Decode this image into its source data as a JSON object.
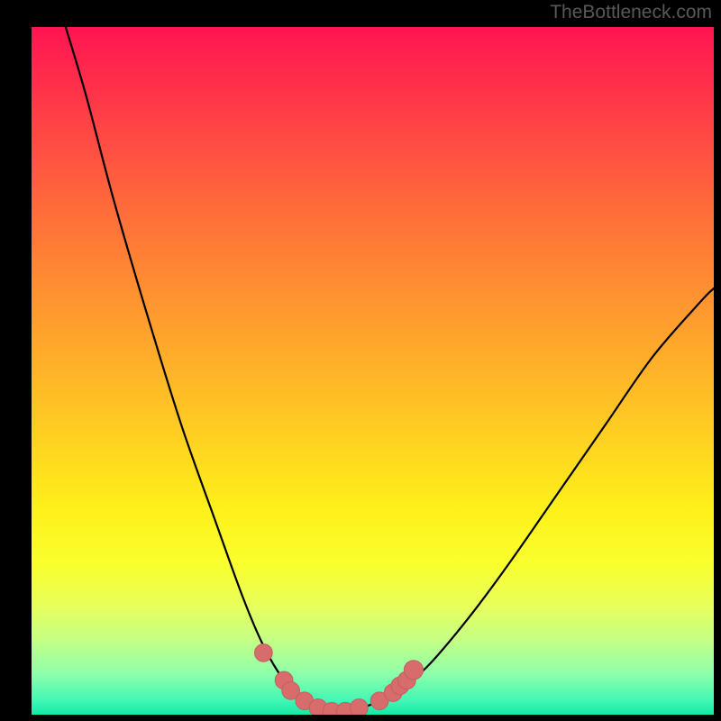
{
  "watermark": "TheBottleneck.com",
  "colors": {
    "page_bg": "#000000",
    "curve": "#000000",
    "marker_fill": "#d86b6b",
    "marker_stroke": "#c25f5f",
    "watermark": "#585858"
  },
  "chart_data": {
    "type": "line",
    "title": "",
    "xlabel": "",
    "ylabel": "",
    "xlim": [
      0,
      100
    ],
    "ylim": [
      0,
      100
    ],
    "grid": false,
    "legend": false,
    "curve_points": [
      {
        "x": 5,
        "y": 100
      },
      {
        "x": 8,
        "y": 90
      },
      {
        "x": 12,
        "y": 75
      },
      {
        "x": 17,
        "y": 58
      },
      {
        "x": 22,
        "y": 42
      },
      {
        "x": 27,
        "y": 28
      },
      {
        "x": 31,
        "y": 17
      },
      {
        "x": 34,
        "y": 10
      },
      {
        "x": 37,
        "y": 5
      },
      {
        "x": 40,
        "y": 2
      },
      {
        "x": 43,
        "y": 0.5
      },
      {
        "x": 46,
        "y": 0.5
      },
      {
        "x": 49,
        "y": 1.2
      },
      {
        "x": 53,
        "y": 3
      },
      {
        "x": 58,
        "y": 7
      },
      {
        "x": 64,
        "y": 14
      },
      {
        "x": 70,
        "y": 22
      },
      {
        "x": 77,
        "y": 32
      },
      {
        "x": 84,
        "y": 42
      },
      {
        "x": 91,
        "y": 52
      },
      {
        "x": 98,
        "y": 60
      },
      {
        "x": 100,
        "y": 62
      }
    ],
    "markers": [
      {
        "x": 34,
        "y": 9,
        "r": 1.3
      },
      {
        "x": 37,
        "y": 5,
        "r": 1.3
      },
      {
        "x": 38,
        "y": 3.5,
        "r": 1.3
      },
      {
        "x": 40,
        "y": 2,
        "r": 1.3
      },
      {
        "x": 42,
        "y": 1,
        "r": 1.3
      },
      {
        "x": 44,
        "y": 0.5,
        "r": 1.3
      },
      {
        "x": 46,
        "y": 0.5,
        "r": 1.3
      },
      {
        "x": 48,
        "y": 1,
        "r": 1.3
      },
      {
        "x": 51,
        "y": 2,
        "r": 1.3
      },
      {
        "x": 53,
        "y": 3.2,
        "r": 1.3
      },
      {
        "x": 54,
        "y": 4.2,
        "r": 1.3
      },
      {
        "x": 55,
        "y": 5,
        "r": 1.3
      },
      {
        "x": 56,
        "y": 6.5,
        "r": 1.4
      }
    ]
  }
}
